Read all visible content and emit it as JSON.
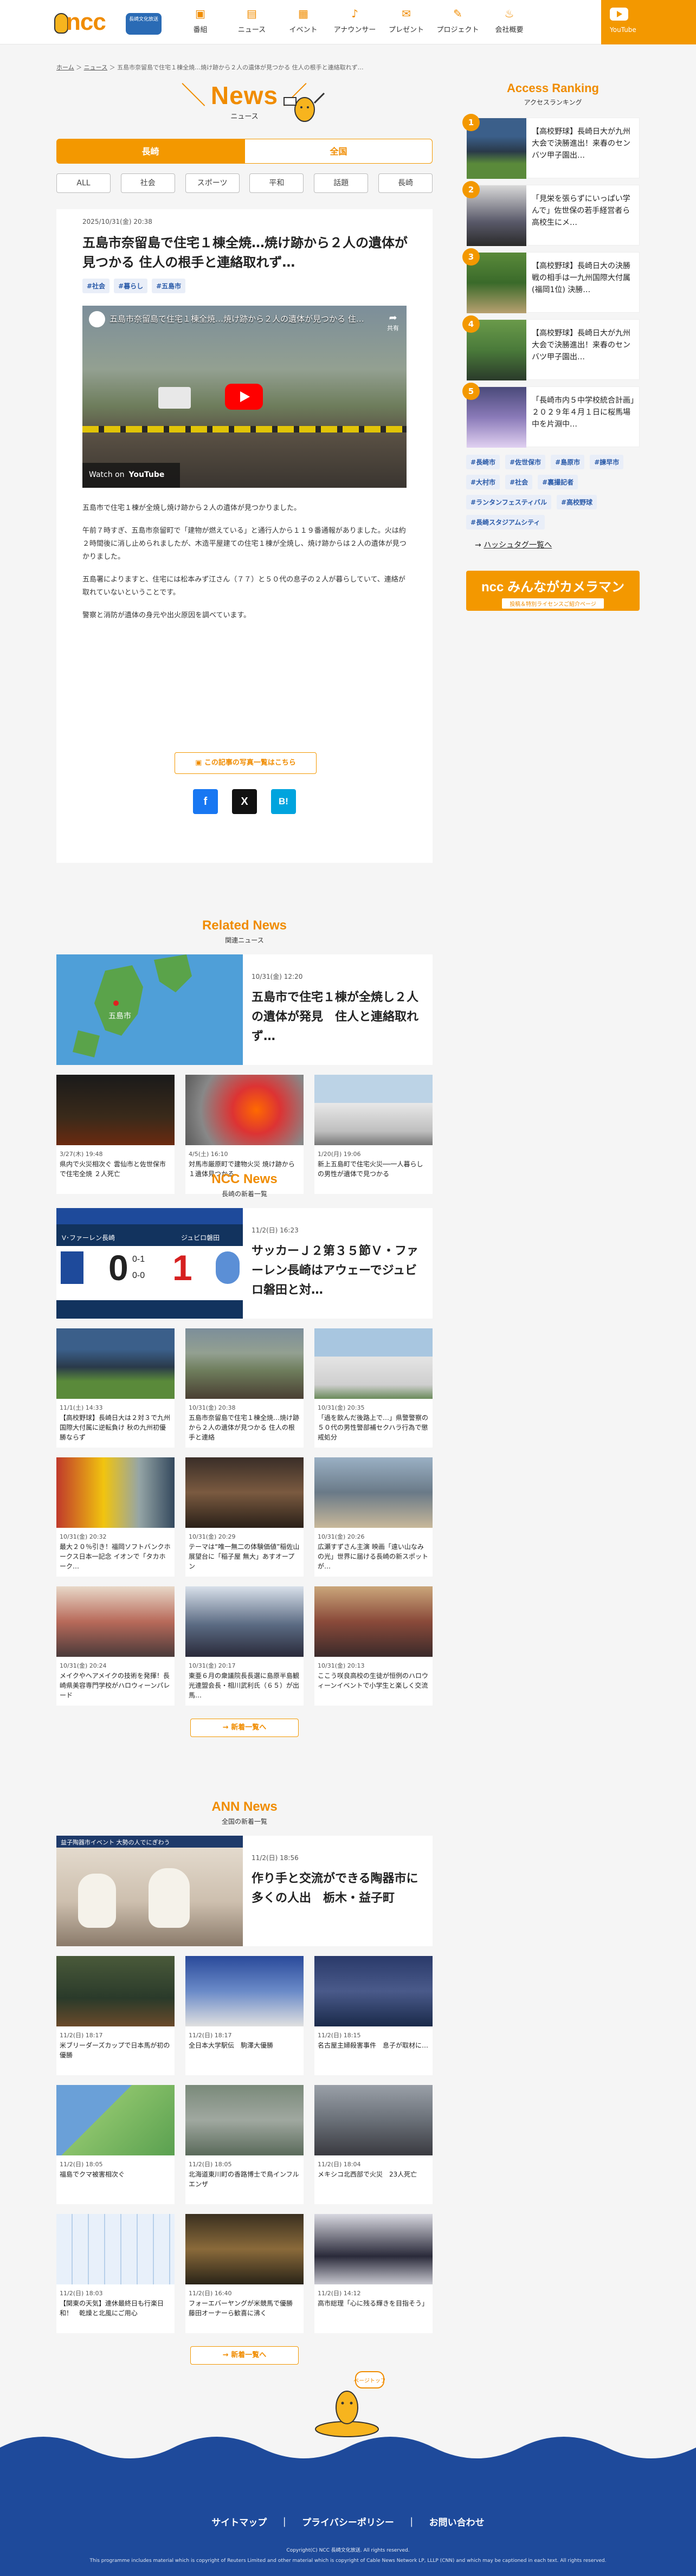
{
  "header": {
    "logo_text": "ncc",
    "logo_badge": "長崎文化放送",
    "nav": [
      {
        "label": "番組",
        "icon": "tv-icon"
      },
      {
        "label": "ニュース",
        "icon": "newspaper-icon"
      },
      {
        "label": "イベント",
        "icon": "calendar-icon"
      },
      {
        "label": "アナウンサー",
        "icon": "microphone-icon"
      },
      {
        "label": "プレゼント",
        "icon": "gift-icon"
      },
      {
        "label": "プロジェクト",
        "icon": "pencil-icon"
      },
      {
        "label": "会社概要",
        "icon": "fire-icon"
      }
    ],
    "youtube_label": "YouTube"
  },
  "breadcrumb": {
    "home": "ホーム",
    "news": "ニュース",
    "current": "五島市奈留島で住宅１棟全焼…焼け跡から２人の遺体が見つかる 住人の根手と連絡取れず…"
  },
  "news_header": {
    "en": "News",
    "jp": "ニュース"
  },
  "region_tabs": {
    "active": "長崎",
    "inactive": "全国"
  },
  "categories": [
    "ALL",
    "社会",
    "スポーツ",
    "平和",
    "話題",
    "長崎"
  ],
  "article": {
    "date": "2025/10/31(金) 20:38",
    "title": "五島市奈留島で住宅１棟全焼…焼け跡から２人の遺体が見つかる 住人の根手と連絡取れず…",
    "tags": [
      "#社会",
      "#暮らし",
      "#五島市"
    ],
    "video_title": "五島市奈留島で住宅１棟全焼…焼け跡から２人の遺体が見つかる 住…",
    "video_share": "共有",
    "watch_on": "Watch on",
    "youtube_word": "YouTube",
    "paragraphs": [
      "五島市で住宅１棟が全焼し焼け跡から２人の遺体が見つかりました。",
      "午前７時すぎ、五島市奈留町で「建物が燃えている」と通行人から１１９番通報がありました。火は約２時間後に消し止められましたが、木造平屋建ての住宅１棟が全焼し、焼け跡からは２人の遺体が見つかりました。",
      "五島署によりますと、住宅には松本みず江さん（７７）と５０代の息子の２人が暮らしていて、連絡が取れていないということです。",
      "警察と消防が遺体の身元や出火原因を調べています。"
    ],
    "photos_button": "この記事の写真一覧はこちら",
    "share_buttons": [
      "f",
      "X",
      "B!"
    ]
  },
  "related": {
    "en": "Related News",
    "jp": "関連ニュース",
    "feature": {
      "date": "10/31(金) 12:20",
      "title": "五島市で住宅１棟が全焼し２人の遺体が発見　住人と連絡取れず…",
      "map_label": "五島市"
    },
    "cards": [
      {
        "date": "3/27(木) 19:48",
        "title": "県内で火災相次ぐ 雲仙市と佐世保市で住宅全焼 ２人死亡"
      },
      {
        "date": "4/5(土) 16:10",
        "title": "対馬市厳原町で建物火災 焼け跡から１遺体見つかる"
      },
      {
        "date": "1/20(月) 19:06",
        "title": "新上五島町で住宅火災──一人暮らしの男性が遺体で見つかる"
      }
    ]
  },
  "ncc_news": {
    "en": "NCC News",
    "jp": "長崎の新着一覧",
    "feature": {
      "date": "11/2(日) 16:23",
      "title": "サッカーＪ２第３５節Ｖ・ファーレン長崎はアウェーでジュビロ磐田と対…",
      "score_home": "0",
      "score_away": "1",
      "score_h1": "0-1",
      "score_h2": "0-0",
      "team_home": "V･ファーレン長崎",
      "team_away": "ジュビロ磐田"
    },
    "cards": [
      {
        "date": "11/1(土) 14:33",
        "title": "【高校野球】長崎日大は２対３で九州国際大付属に逆転負け 秋の九州初優勝ならず"
      },
      {
        "date": "10/31(金) 20:38",
        "title": "五島市奈留島で住宅１棟全焼…焼け跡から２人の遺体が見つかる 住人の根手と連絡"
      },
      {
        "date": "10/31(金) 20:35",
        "title": "「過を飲んだ後路上で…」県警警察の５０代の男性警部補セクハラ行為で懲戒処分"
      },
      {
        "date": "10/31(金) 20:32",
        "title": "最大２０％引き！福岡ソフトバンクホークス日本一記念 イオンで「タカホーク…"
      },
      {
        "date": "10/31(金) 20:29",
        "title": "テーマは“唯一無二の体験価値”稲佐山展望台に「稲子屋 無大」あすオープン"
      },
      {
        "date": "10/31(金) 20:26",
        "title": "広瀬すずさん主演 映画「遠い山なみの光」世界に届ける長崎の新スポットが…"
      },
      {
        "date": "10/31(金) 20:24",
        "title": "メイクやヘアメイクの技術を発揮！長崎県美容専門学校がハロウィーンパレード"
      },
      {
        "date": "10/31(金) 20:17",
        "title": "東亜６月の衆議院長長選に島原半島観光連盟会長・相川武利氏（６５）が出馬…"
      },
      {
        "date": "10/31(金) 20:13",
        "title": "ここう咲良高校の生徒が恒例のハロウィーンイベントで小学生と楽しく交流"
      }
    ],
    "more": "新着一覧へ"
  },
  "ann_news": {
    "en": "ANN News",
    "jp": "全国の新着一覧",
    "feature": {
      "date": "11/2(日) 18:56",
      "title": "作り手と交流ができる陶器市に多くの人出　栃木・益子町",
      "banner": "益子陶器市イベント 大勢の人でにぎわう"
    },
    "cards": [
      {
        "date": "11/2(日) 18:17",
        "title": "米ブリーダーズカップで日本馬が初の優勝"
      },
      {
        "date": "11/2(日) 18:17",
        "title": "全日本大学駅伝　駒澤大優勝"
      },
      {
        "date": "11/2(日) 18:15",
        "title": "名古屋主婦殺害事件　息子が取材に…"
      },
      {
        "date": "11/2(日) 18:05",
        "title": "福島でクマ被害相次ぐ"
      },
      {
        "date": "11/2(日) 18:05",
        "title": "北海道東川町の香路博士で鳥インフルエンザ"
      },
      {
        "date": "11/2(日) 18:04",
        "title": "メキシコ北西部で火災　23人死亡"
      },
      {
        "date": "11/2(日) 18:03",
        "title": "【関東の天気】連休最終日も行楽日和！　乾燥と北風にご用心"
      },
      {
        "date": "11/2(日) 16:40",
        "title": "フォーエバーヤングが米競馬で優勝 藤田オーナーら歓喜に沸く"
      },
      {
        "date": "11/2(日) 14:12",
        "title": "高市総理「心に残る輝きを目指そう」"
      }
    ],
    "more": "新着一覧へ"
  },
  "sidebar": {
    "ranking_en": "Access Ranking",
    "ranking_jp": "アクセスランキング",
    "ranking": [
      {
        "num": "1",
        "title": "【高校野球】長崎日大が九州大会で決勝進出！来春のセンバツ甲子園出…"
      },
      {
        "num": "2",
        "title": "「見栄を張らずにいっぱい学んで」佐世保の若手経営者ら高校生にメ…"
      },
      {
        "num": "3",
        "title": "【高校野球】長崎日大の決勝戦の相手は一九州国際大付属(福岡1位) 決勝…"
      },
      {
        "num": "4",
        "title": "【高校野球】長崎日大が九州大会で決勝進出！来春のセンバツ甲子園出…"
      },
      {
        "num": "5",
        "title": "「長崎市内５中学校統合計画」２０２９年４月１日に桜馬場中を片淵中…"
      }
    ],
    "tags": [
      "#長崎市",
      "#佐世保市",
      "#島原市",
      "#諫早市",
      "#大村市",
      "#社会",
      "#裏撮記者",
      "#ランタンフェスティバル",
      "#高校野球",
      "#長崎スタジアムシティ"
    ],
    "hashtag_link": "ハッシュタグ一覧へ",
    "banner_title": "ncc みんながカメラマン",
    "banner_sub": "投稿＆特別ライセンスご紹介ページ"
  },
  "footer": {
    "links": [
      "サイトマップ",
      "プライバシーポリシー",
      "お問い合わせ"
    ],
    "separator": "｜",
    "copyright": "Copyright(C) NCC 長崎文化放送. All rights reserved.",
    "notice": "This programme includes material which is copyright of Reuters Limited and other material which is copyright of Cable News Network LP, LLLP (CNN) and which may be captioned in each text. All rights reserved.",
    "pagetop": "ページトップ"
  },
  "colors": {
    "accent": "#f39800",
    "accent_text": "#f08c00",
    "footer_blue": "#1e4a9b",
    "tag_blue": "#2a5aa8"
  }
}
